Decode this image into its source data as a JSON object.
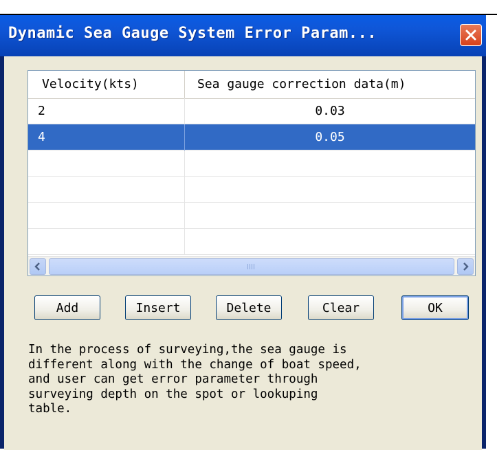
{
  "window": {
    "title": "Dynamic Sea Gauge System Error Param..."
  },
  "table": {
    "columns": [
      "Velocity(kts)",
      "Sea gauge correction data(m)"
    ],
    "rows": [
      {
        "velocity": "2",
        "correction": "0.03",
        "selected": false
      },
      {
        "velocity": "4",
        "correction": "0.05",
        "selected": true
      }
    ],
    "empty_rows": 4
  },
  "buttons": {
    "add": "Add",
    "insert": "Insert",
    "delete": "Delete",
    "clear": "Clear",
    "ok": "OK"
  },
  "description": "In the process of surveying,the sea gauge is\ndifferent along with the change of boat speed,\nand user can get error parameter through\nsurveying depth on the spot or lookuping\ntable.",
  "colors": {
    "titlebar": "#0a5ce3",
    "selection": "#316ac5",
    "dialog_bg": "#ece9d8",
    "close_button": "#d8421c"
  }
}
